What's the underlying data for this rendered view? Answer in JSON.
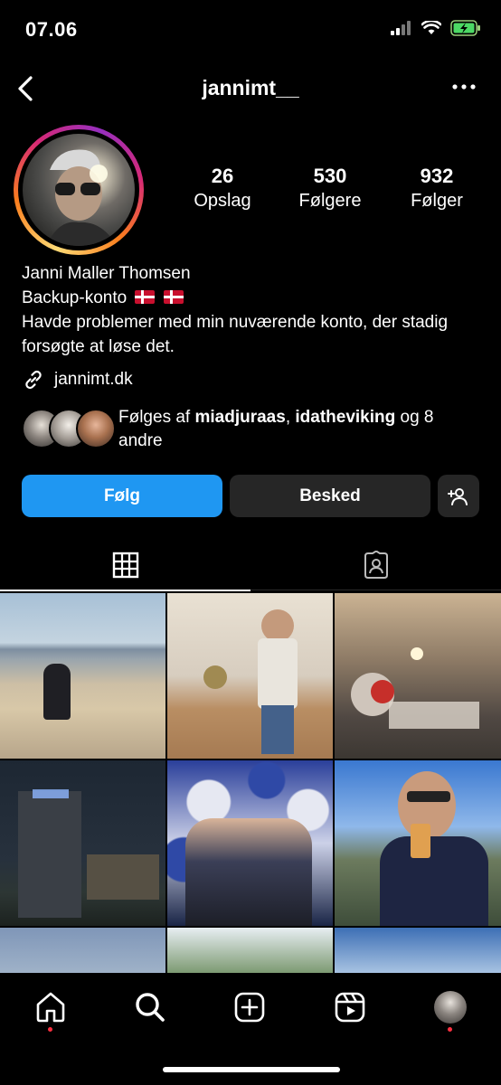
{
  "status_bar": {
    "time": "07.06"
  },
  "header": {
    "username": "jannimt__"
  },
  "profile": {
    "stats": [
      {
        "value": "26",
        "label": "Opslag"
      },
      {
        "value": "530",
        "label": "Følgere"
      },
      {
        "value": "932",
        "label": "Følger"
      }
    ],
    "name": "Janni Maller Thomsen",
    "bio_line1": "Backup-konto",
    "bio_line2": "Havde problemer med min nuværende konto, der stadig forsøgte at løse det.",
    "link": "jannimt.dk",
    "followed_by_prefix": "Følges af ",
    "followed_by_user1": "miadjuraas",
    "followed_by_sep": ", ",
    "followed_by_user2": "idatheviking",
    "followed_by_suffix": " og 8 andre"
  },
  "actions": {
    "follow_label": "Følg",
    "message_label": "Besked"
  },
  "colors": {
    "accent": "#1f97f2",
    "secondary_button": "#262626",
    "notification_dot": "#ff3040"
  },
  "icons": {
    "back": "chevron-left-icon",
    "more": "more-horizontal-icon",
    "link": "link-icon",
    "add_user": "add-person-icon",
    "grid": "grid-icon",
    "tagged": "tagged-icon",
    "home": "home-icon",
    "search": "search-icon",
    "create": "create-icon",
    "reels": "reels-icon"
  }
}
